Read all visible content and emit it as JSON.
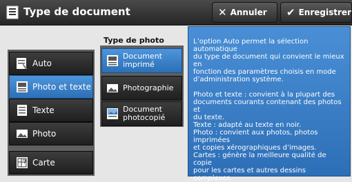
{
  "header": {
    "title": "Type de document",
    "cancel_label": "Annuler",
    "save_label": "Enregistrer"
  },
  "left_list": {
    "items": [
      {
        "label": "Auto",
        "icon": "auto-document-icon",
        "selected": false
      },
      {
        "label": "Photo et texte",
        "icon": "photo-text-icon",
        "selected": true
      },
      {
        "label": "Texte",
        "icon": "text-document-icon",
        "selected": false
      },
      {
        "label": "Photo",
        "icon": "photo-icon",
        "selected": false
      },
      {
        "label": "Carte",
        "icon": "map-icon",
        "selected": false
      }
    ]
  },
  "photo_type": {
    "label": "Type de photo",
    "items": [
      {
        "label_line1": "Document",
        "label_line2": "imprimé",
        "icon": "printed-document-icon",
        "selected": true
      },
      {
        "label_line1": "Photographie",
        "label_line2": "",
        "icon": "photograph-icon",
        "selected": false
      },
      {
        "label_line1": "Document",
        "label_line2": "photocopié",
        "icon": "photocopied-document-icon",
        "selected": false
      }
    ]
  },
  "info_panel": {
    "para1": [
      "L’option Auto permet la sélection automatique",
      "du type de document qui convient le mieux en",
      "fonction des paramètres choisis en mode",
      "d’administration système."
    ],
    "para2": [
      "Photo et texte : convient à la plupart des",
      "documents  courants contenant des photos et",
      "du texte.",
      "Texte : adapté au texte en noir.",
      "Photo : convient aux photos, photos imprimées",
      "et copies xérographiques d’images.",
      "Cartes : génère la meilleure qualité de copie",
      "pour les cartes et autres dessins complexes."
    ]
  },
  "colors": {
    "selected": "#3a82cc",
    "button_dark": "#2a2a2a",
    "header": "#333333"
  }
}
